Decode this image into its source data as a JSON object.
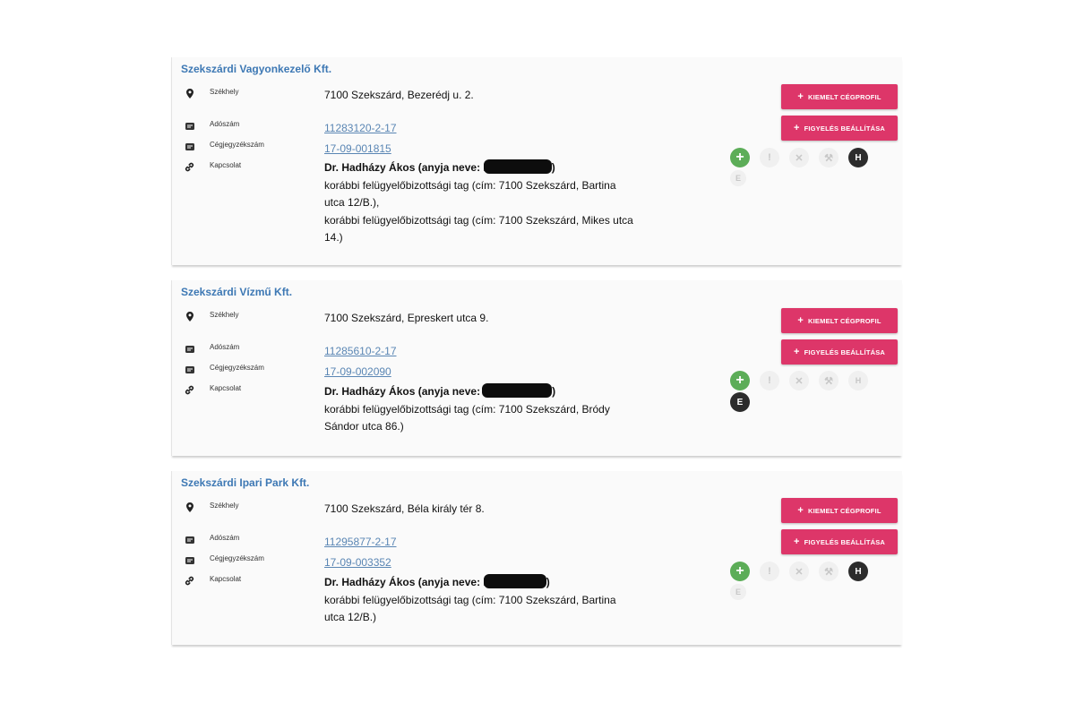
{
  "labels": {
    "seat": "Székhely",
    "tax": "Adószám",
    "reg": "Cégjegyzékszám",
    "conn": "Kapcsolat",
    "featured_btn": "KIEMELT CÉGPROFIL",
    "watch_btn": "FIGYELÉS BEÁLLÍTÁSA",
    "icon_excl": "!",
    "icon_x": "✕",
    "icon_hammer": "⚒",
    "icon_h": "H",
    "icon_e": "E",
    "icon_plus": "+"
  },
  "companies": [
    {
      "name": "Szekszárdi Vagyonkezelő Kft.",
      "seat": "7100 Szekszárd, Bezerédj u. 2.",
      "tax": "11283120-2-17",
      "reg": "17-09-001815",
      "person": "Dr. Hadházy Ákos (anyja neve: I",
      "person_end": ")",
      "roles": [
        "korábbi felügyelőbizottsági tag (cím: 7100 Szekszárd, Bartina",
        "utca 12/B.),",
        "korábbi felügyelőbizottsági tag (cím: 7100 Szekszárd, Mikes utca",
        "14.)"
      ],
      "h_active": true,
      "e_active": false
    },
    {
      "name": "Szekszárdi Vízmű Kft.",
      "seat": "7100 Szekszárd, Epreskert utca 9.",
      "tax": "11285610-2-17",
      "reg": "17-09-002090",
      "person": "Dr. Hadházy Ákos (anyja neve:",
      "person_end": ")",
      "roles": [
        "korábbi felügyelőbizottsági tag (cím: 7100 Szekszárd, Bródy",
        "Sándor utca 86.)"
      ],
      "h_active": false,
      "e_active": true
    },
    {
      "name": "Szekszárdi Ipari Park Kft.",
      "seat": "7100 Szekszárd, Béla király tér 8.",
      "tax": "11295877-2-17",
      "reg": "17-09-003352",
      "person": "Dr. Hadházy Ákos (anyja neve: I",
      "person_end": ")",
      "roles": [
        "korábbi felügyelőbizottsági tag (cím: 7100 Szekszárd, Bartina",
        "utca 12/B.)"
      ],
      "h_active": true,
      "e_active": false
    }
  ]
}
